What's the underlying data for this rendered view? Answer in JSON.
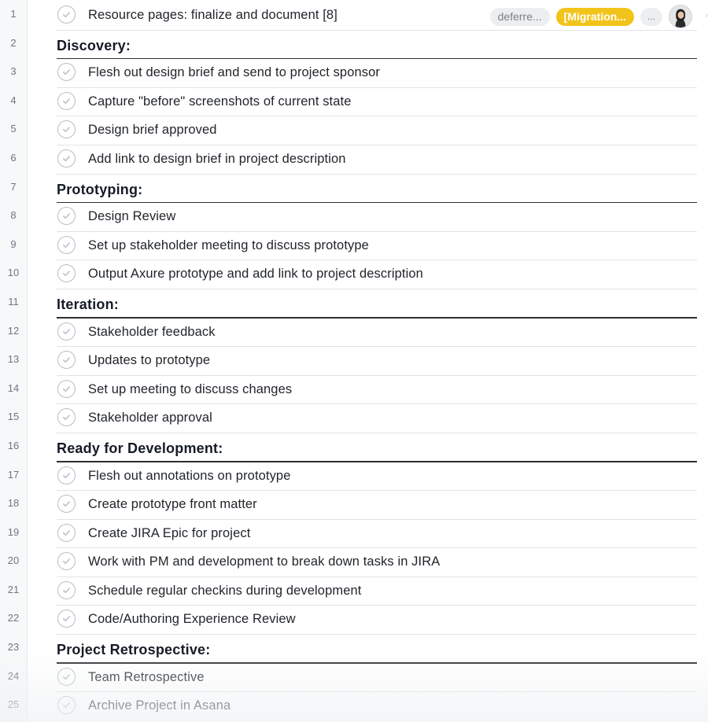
{
  "rows": [
    {
      "num": "1",
      "type": "task",
      "label": "Resource pages: finalize and document [8]",
      "tags": {
        "deferred": "deferre...",
        "migration": "[Migration...",
        "more": "..."
      }
    },
    {
      "num": "2",
      "type": "section",
      "label": "Discovery:"
    },
    {
      "num": "3",
      "type": "task",
      "label": "Flesh out design brief and send to project sponsor"
    },
    {
      "num": "4",
      "type": "task",
      "label": "Capture \"before\" screenshots of current state"
    },
    {
      "num": "5",
      "type": "task",
      "label": "Design brief approved"
    },
    {
      "num": "6",
      "type": "task",
      "label": "Add link to design brief in project description"
    },
    {
      "num": "7",
      "type": "section",
      "label": "Prototyping:"
    },
    {
      "num": "8",
      "type": "task",
      "label": "Design Review"
    },
    {
      "num": "9",
      "type": "task",
      "label": "Set up stakeholder meeting to discuss prototype"
    },
    {
      "num": "10",
      "type": "task",
      "label": "Output Axure prototype and add link to project description"
    },
    {
      "num": "11",
      "type": "section",
      "label": "Iteration:"
    },
    {
      "num": "12",
      "type": "task",
      "label": "Stakeholder feedback"
    },
    {
      "num": "13",
      "type": "task",
      "label": "Updates to prototype"
    },
    {
      "num": "14",
      "type": "task",
      "label": "Set up meeting to discuss changes"
    },
    {
      "num": "15",
      "type": "task",
      "label": "Stakeholder approval"
    },
    {
      "num": "16",
      "type": "section",
      "label": "Ready for Development:"
    },
    {
      "num": "17",
      "type": "task",
      "label": "Flesh out annotations on prototype"
    },
    {
      "num": "18",
      "type": "task",
      "label": "Create prototype front matter"
    },
    {
      "num": "19",
      "type": "task",
      "label": "Create JIRA Epic for project"
    },
    {
      "num": "20",
      "type": "task",
      "label": "Work with PM and development to break down tasks in JIRA"
    },
    {
      "num": "21",
      "type": "task",
      "label": "Schedule regular checkins during development"
    },
    {
      "num": "22",
      "type": "task",
      "label": "Code/Authoring Experience Review"
    },
    {
      "num": "23",
      "type": "section",
      "label": "Project Retrospective:"
    },
    {
      "num": "24",
      "type": "task",
      "label": "Team Retrospective"
    },
    {
      "num": "25",
      "type": "task",
      "label": "Archive Project in Asana"
    }
  ],
  "icons": {
    "check": "check-circle-icon",
    "avatar": "user-avatar",
    "chevron": "chevron-right-icon"
  },
  "colors": {
    "migration_tag": "#f2c31a",
    "deferred_tag": "#eceef0",
    "section_rule": "#2b2f33",
    "row_rule": "#e1e4e8"
  }
}
